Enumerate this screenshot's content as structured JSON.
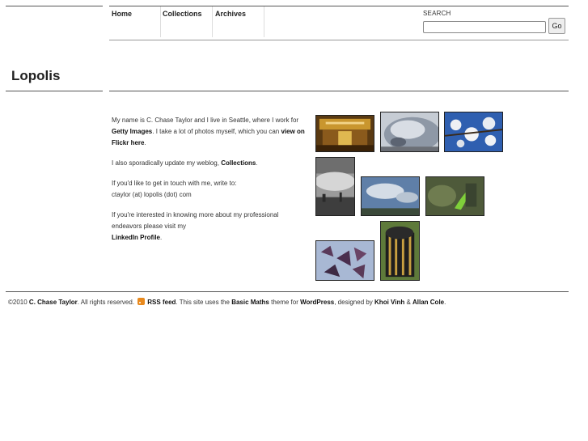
{
  "nav": {
    "items": [
      {
        "label": "Home"
      },
      {
        "label": "Collections"
      },
      {
        "label": "Archives"
      }
    ]
  },
  "search": {
    "label": "SEARCH",
    "value": "",
    "button_label": "Go"
  },
  "site": {
    "title": "Lopolis"
  },
  "bio": {
    "p1_a": "My name is C. Chase Taylor and I live in Seattle, where I work for ",
    "p1_link1": "Getty Images",
    "p1_b": ". I take a lot of photos myself, which you can ",
    "p1_link2": "view on Flickr here",
    "p1_c": ".",
    "p2_a": "I also sporadically update my weblog, ",
    "p2_link": "Collections",
    "p2_b": ".",
    "p3_a": "If you'd like to get in touch with me, write to:",
    "p3_b": "ctaylor (at) lopolis (dot) com",
    "p4_a": "If you're interested in knowing more about my professional endeavors please visit my",
    "p4_link": "LinkedIn Profile",
    "p4_b": "."
  },
  "footer": {
    "copyright": "©2010 ",
    "author": "C. Chase Taylor",
    "rights": ". All rights reserved. ",
    "rss_link": "RSS feed",
    "text1": ". This site uses the ",
    "theme_link": "Basic Maths",
    "text2": " theme for ",
    "wp_link": "WordPress",
    "text3": ", designed by ",
    "designer1": "Khoi Vinh",
    "amp": " & ",
    "designer2": "Allan Cole",
    "end": "."
  },
  "icons": {
    "rss": "rss-icon"
  }
}
